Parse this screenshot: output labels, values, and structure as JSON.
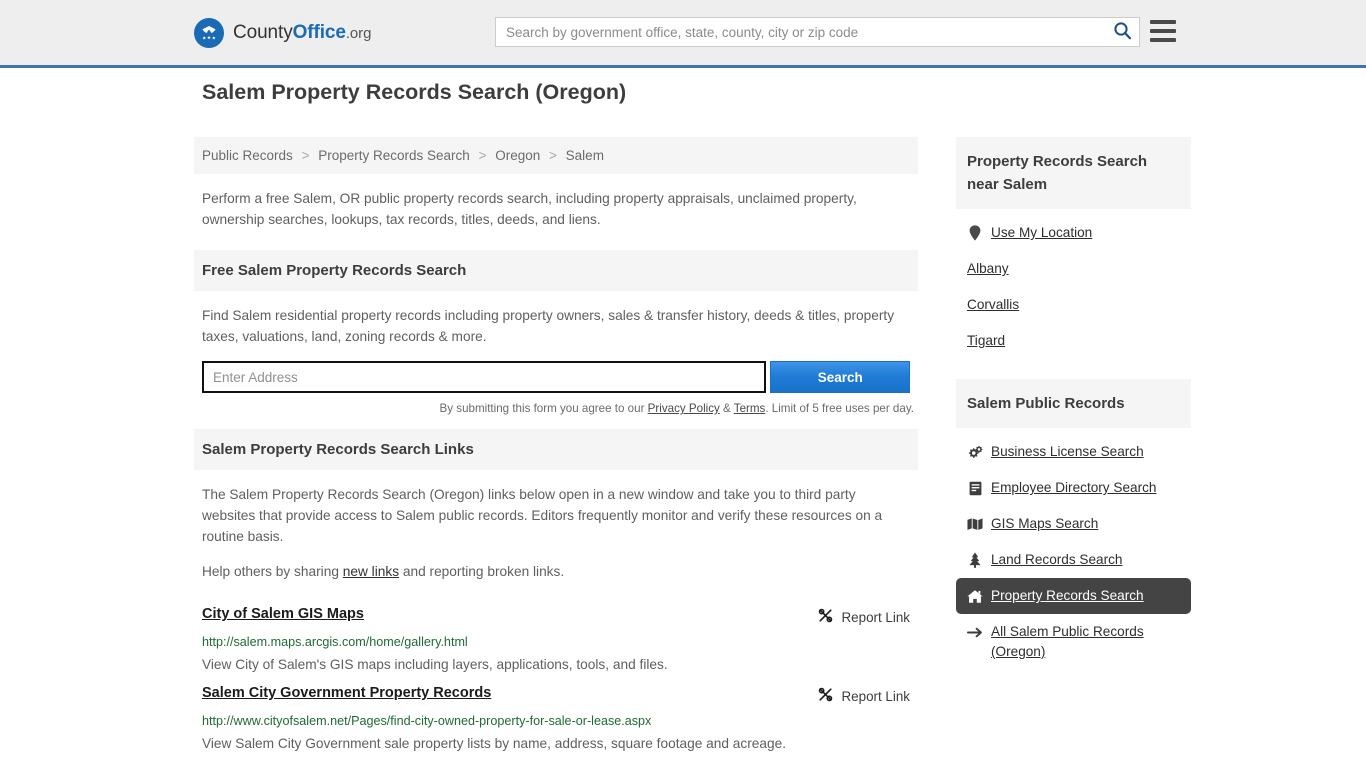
{
  "header": {
    "brand": {
      "part1": "County",
      "part2": "Office",
      "part3": ".org",
      "logo_icon": "eagle-shield-logo"
    },
    "search_placeholder": "Search by government office, state, county, city or zip code",
    "search_value": "",
    "search_icon": "search-icon",
    "menu_icon": "hamburger-menu-icon",
    "accent_color": "#3b77ad"
  },
  "main": {
    "page_title": "Salem Property Records Search (Oregon)",
    "breadcrumb": [
      {
        "label": "Public Records"
      },
      {
        "label": "Property Records Search"
      },
      {
        "label": "Oregon"
      },
      {
        "label": "Salem"
      }
    ],
    "breadcrumb_separator": ">",
    "intro": "Perform a free Salem, OR public property records search, including property appraisals, unclaimed property, ownership searches, lookups, tax records, titles, deeds, and liens.",
    "free_search": {
      "heading": "Free Salem Property Records Search",
      "description": "Find Salem residential property records including property owners, sales & transfer history, deeds & titles, property taxes, valuations, land, zoning records & more.",
      "input_placeholder": "Enter Address",
      "input_value": "",
      "button_label": "Search",
      "button_color": "#1e7ad4",
      "disclaimer_pre": "By submitting this form you agree to our ",
      "disclaimer_privacy": "Privacy Policy",
      "disclaimer_amp": " & ",
      "disclaimer_terms": "Terms",
      "disclaimer_post": ". Limit of 5 free uses per day."
    },
    "links_section": {
      "heading": "Salem Property Records Search Links",
      "paragraph": "The Salem Property Records Search (Oregon) links below open in a new window and take you to third party websites that provide access to Salem public records. Editors frequently monitor and verify these resources on a routine basis.",
      "help_pre": "Help others by sharing ",
      "help_link": "new links",
      "help_post": " and reporting broken links.",
      "report_label": "Report Link",
      "report_icon": "broken-link-icon",
      "items": [
        {
          "title": "City of Salem GIS Maps",
          "url": "http://salem.maps.arcgis.com/home/gallery.html",
          "description": "View City of Salem's GIS maps including layers, applications, tools, and files."
        },
        {
          "title": "Salem City Government Property Records",
          "url": "http://www.cityofsalem.net/Pages/find-city-owned-property-for-sale-or-lease.aspx",
          "description": "View Salem City Government sale property lists by name, address, square footage and acreage."
        }
      ]
    }
  },
  "sidebar": {
    "near_panel": {
      "heading": "Property Records Search near Salem",
      "items": [
        {
          "label": "Use My Location",
          "icon": "map-pin-icon"
        },
        {
          "label": "Albany",
          "icon": ""
        },
        {
          "label": "Corvallis",
          "icon": ""
        },
        {
          "label": "Tigard",
          "icon": ""
        }
      ]
    },
    "records_panel": {
      "heading": "Salem Public Records",
      "items": [
        {
          "label": "Business License Search",
          "icon": "gears-icon",
          "active": false
        },
        {
          "label": "Employee Directory Search",
          "icon": "book-icon",
          "active": false
        },
        {
          "label": "GIS Maps Search",
          "icon": "map-icon",
          "active": false
        },
        {
          "label": "Land Records Search",
          "icon": "tree-icon",
          "active": false
        },
        {
          "label": "Property Records Search",
          "icon": "home-icon",
          "active": true
        },
        {
          "label": "All Salem Public Records (Oregon)",
          "icon": "arrow-right-icon",
          "active": false
        }
      ],
      "active_color": "#444444"
    }
  }
}
